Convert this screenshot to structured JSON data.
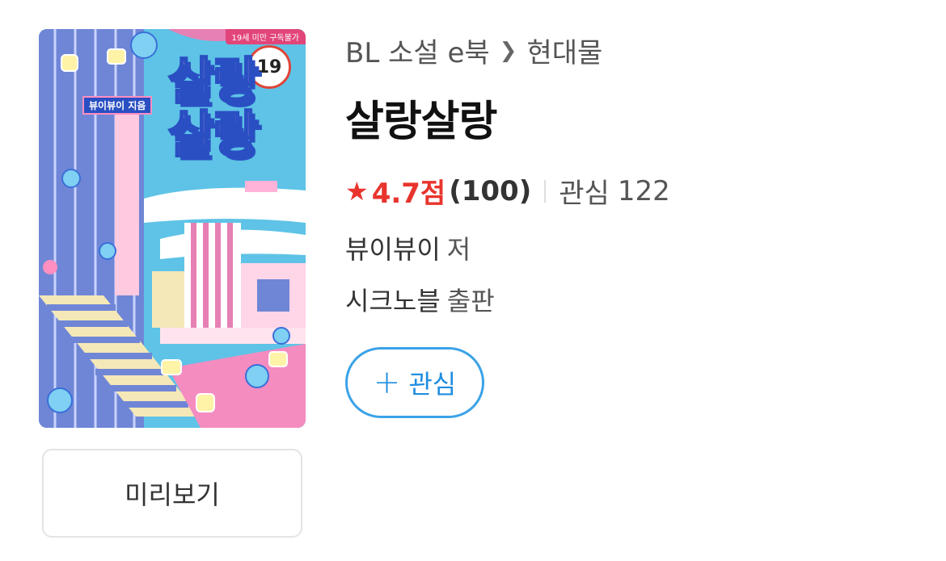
{
  "book": {
    "cover": {
      "title_line1": "살랑",
      "title_line2": "살랑",
      "author_tag": "뷰이뷰이 지음",
      "age_badge": "19",
      "age_notice": "19세 미만 구독불가",
      "colors": {
        "sky": "#5ec3e6",
        "navy": "#2a4fc3",
        "pink": "#ffb3d9",
        "cream": "#f5e8b8"
      }
    },
    "preview_label": "미리보기"
  },
  "breadcrumb": {
    "category": "BL 소설 e북",
    "subcategory": "현대물"
  },
  "title": "살랑살랑",
  "rating": {
    "score": "4.7점",
    "count": "(100)",
    "star_icon": "star-icon",
    "star_color": "#e8342d"
  },
  "interest": {
    "label": "관심",
    "count": "122"
  },
  "author": {
    "name": "뷰이뷰이",
    "suffix": "저"
  },
  "publisher": {
    "name": "시크노블",
    "suffix": "출판"
  },
  "follow_button": {
    "icon": "plus-icon",
    "label": "관심",
    "color": "#3aa2e8"
  }
}
